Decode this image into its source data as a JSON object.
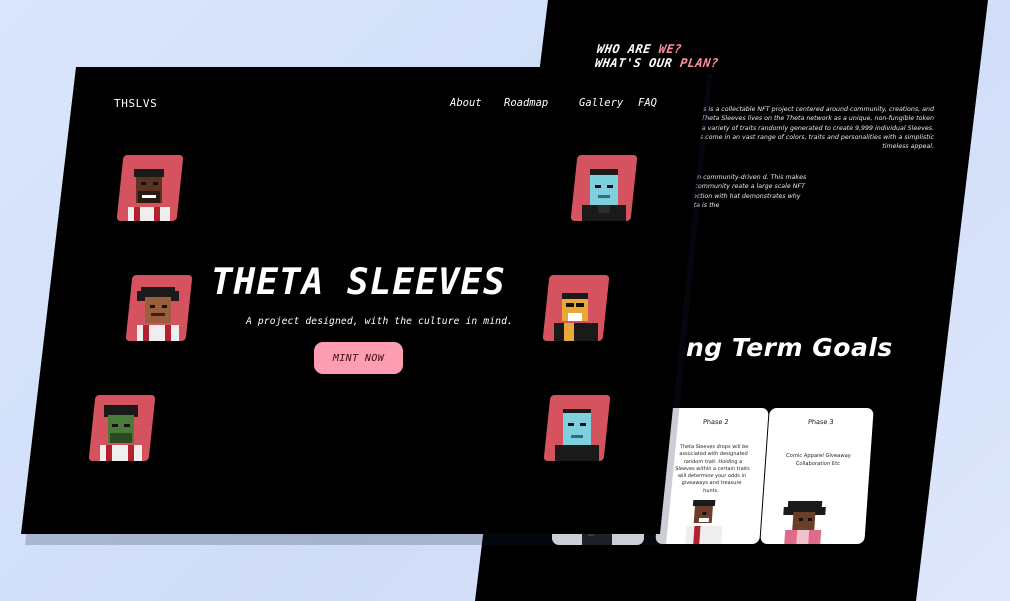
{
  "colors": {
    "accent_pink": "#ff9db0",
    "highlight": "#ff8fa3",
    "avatar_bg": "#d4535f",
    "page_bg": "#000000"
  },
  "front": {
    "logo": "THSLVS",
    "nav": [
      "About",
      "Roadmap",
      "Gallery",
      "FAQ"
    ],
    "hero_title": "THETA SLEEVES",
    "hero_subtitle": "A project designed, with the culture in mind.",
    "cta_label": "MINT NOW"
  },
  "back": {
    "title_line1_a": "WHO ARE ",
    "title_line1_b": "WE?",
    "title_line2_a": "WHAT'S OUR ",
    "title_line2_b": "PLAN?",
    "paragraph1": "Theta Sleeves is a collectable NFT project centered around community, creations, and growth. Each Theta Sleeves lives on the Theta network as a unique, non-fungible token (NFT) made from a variety of traits randomly generated to create 9,999 individual Sleeves. Theta Sleeves come in an vast range of colors, traits and personalities with a simplistic timeless appeal.",
    "paragraph2": "join in community-driven d. This makes our community reate a large scale NFT collection with hat demonstrates why Theta is the",
    "goals_heading": "ng Term Goals",
    "phases": [
      {
        "title": "Phase 2",
        "desc": "Theta Sleeves drops will be associated with designated random trait. Holding a Sleeves within a certain traits will determine your odds in giveaways and treasure hunts."
      },
      {
        "title": "Phase 3",
        "desc": "Comic Apparel Giveaway Collaboration Etc"
      }
    ]
  }
}
